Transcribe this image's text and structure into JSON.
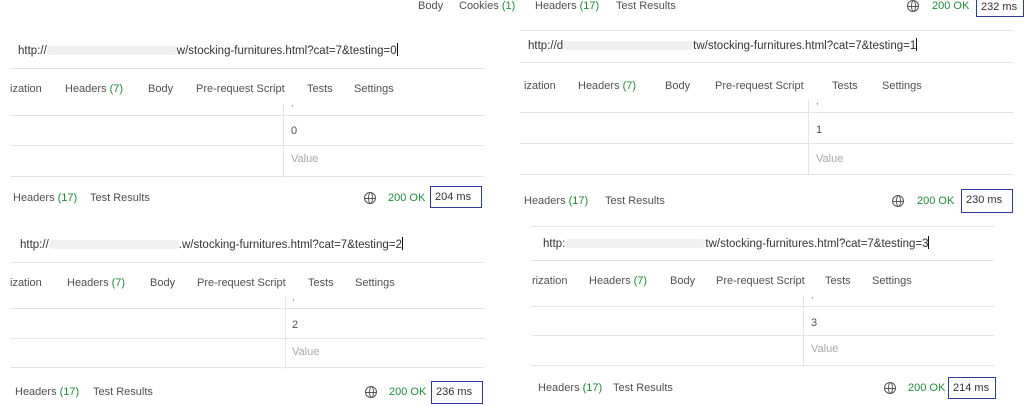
{
  "top_bar": {
    "tabs": [
      "Body",
      "Cookies",
      "Headers",
      "Test Results"
    ],
    "body_visible": "Body",
    "cookies_label": "Cookies",
    "cookies_count": "(1)",
    "headers_label": "Headers",
    "headers_count": "(17)",
    "test_results": "Test Results",
    "status": "200 OK",
    "time": "232 ms"
  },
  "panels": [
    {
      "url_prefix": "http://",
      "url_suffix": "w/stocking-furnitures.html?cat=7&testing=0",
      "req_tabs": [
        "ization",
        "Headers",
        "(7)",
        "Body",
        "Pre-request Script",
        "Tests",
        "Settings"
      ],
      "row_value": "0",
      "value_placeholder": "Value",
      "resp_headers_label": "Headers",
      "resp_headers_count": "(17)",
      "resp_test_results": "Test Results",
      "status": "200 OK",
      "time": "204 ms"
    },
    {
      "url_prefix": "http://d",
      "url_suffix": "tw/stocking-furnitures.html?cat=7&testing=1",
      "req_tabs": [
        "ization",
        "Headers",
        "(7)",
        "Body",
        "Pre-request Script",
        "Tests",
        "Settings"
      ],
      "row_value": "1",
      "value_placeholder": "Value",
      "resp_headers_label": "Headers",
      "resp_headers_count": "(17)",
      "resp_test_results": "Test Results",
      "status": "200 OK",
      "time": "230 ms"
    },
    {
      "url_prefix": "http://",
      "url_suffix": ".w/stocking-furnitures.html?cat=7&testing=2",
      "req_tabs": [
        "ization",
        "Headers",
        "(7)",
        "Body",
        "Pre-request Script",
        "Tests",
        "Settings"
      ],
      "row_value": "2",
      "value_placeholder": "Value",
      "resp_headers_label": "Headers",
      "resp_headers_count": "(17)",
      "resp_test_results": "Test Results",
      "status": "200 OK",
      "time": "236 ms"
    },
    {
      "url_prefix": "http:",
      "url_suffix": "tw/stocking-furnitures.html?cat=7&testing=3",
      "req_tabs": [
        "rization",
        "Headers",
        "(7)",
        "Body",
        "Pre-request Script",
        "Tests",
        "Settings"
      ],
      "row_value": "3",
      "value_placeholder": "Value",
      "resp_headers_label": "Headers",
      "resp_headers_count": "(17)",
      "resp_test_results": "Test Results",
      "status": "200 OK",
      "time": "214 ms"
    }
  ],
  "icons": {
    "globe": "globe-icon"
  },
  "colors": {
    "ok_green": "#1f8a3a",
    "time_box_border": "#2e3a9c"
  }
}
